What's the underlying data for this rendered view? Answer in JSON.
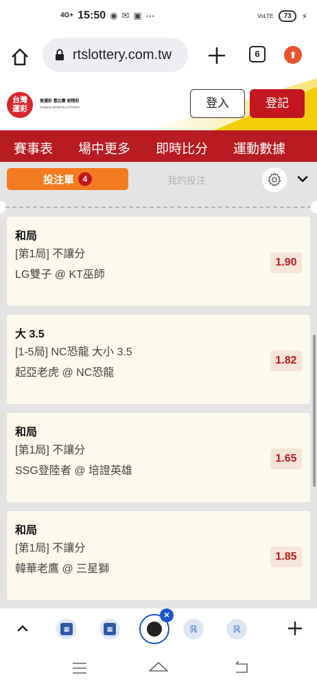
{
  "status_bar": {
    "network": "4G+",
    "time": "15:50",
    "dots": "···",
    "volte": "VoLTE",
    "battery": "73"
  },
  "browser": {
    "url": "rtslottery.com.tw",
    "tab_count": "6"
  },
  "site_header": {
    "logo_text": "台灣\n運彩",
    "logo_slogan": "買運彩 看比賽 更精彩",
    "logo_subtitle": "TAIWAN SPORTS LOTTERY",
    "login_label": "登入",
    "register_label": "登記"
  },
  "nav": {
    "items": [
      {
        "label": "賽事表"
      },
      {
        "label": "場中更多"
      },
      {
        "label": "即時比分"
      },
      {
        "label": "運動數據"
      }
    ]
  },
  "bet_slip": {
    "active_tab_label": "投注單",
    "active_tab_count": "4",
    "my_bets_label": "我的投注",
    "selections": [
      {
        "title": "和局",
        "market": "[第1局] 不讓分",
        "match": "LG雙子 @ KT巫師",
        "odds": "1.90"
      },
      {
        "title": "大 3.5",
        "market": "[1-5局] NC恐龍 大小 3.5",
        "match": "起亞老虎 @ NC恐龍",
        "odds": "1.82"
      },
      {
        "title": "和局",
        "market": "[第1局] 不讓分",
        "match": "SSG登陸者 @ 培證英雄",
        "odds": "1.65"
      },
      {
        "title": "和局",
        "market": "[第1局] 不讓分",
        "match": "韓華老鷹 @ 三星獅",
        "odds": "1.85"
      }
    ]
  },
  "colors": {
    "brand_red": "#b81b21",
    "accent_orange": "#f47b20",
    "accent_yellow": "#f3cf0b",
    "odds_text": "#b81b21"
  }
}
